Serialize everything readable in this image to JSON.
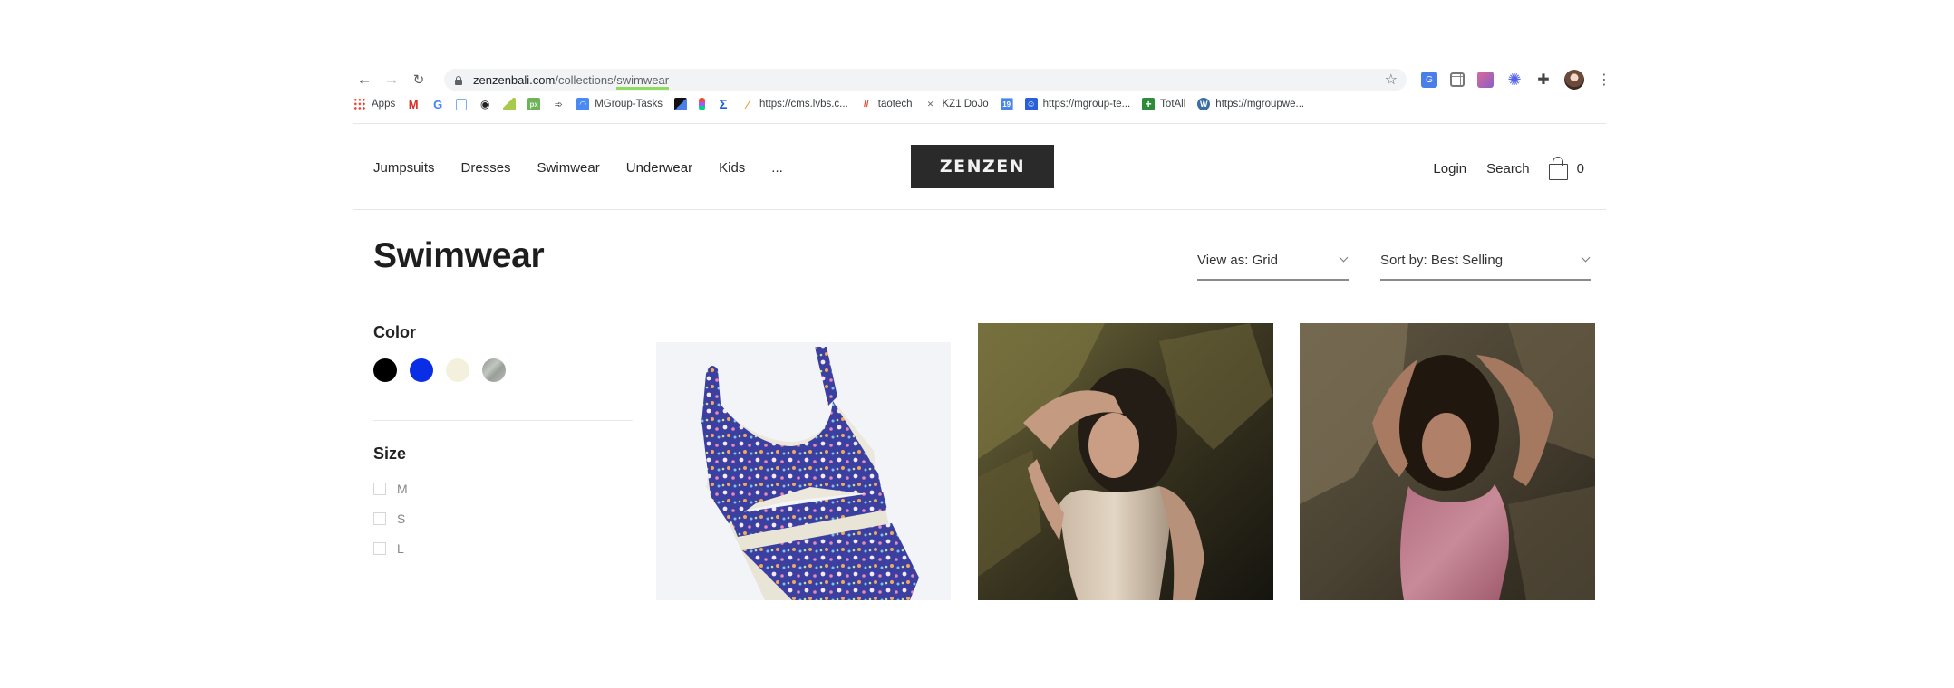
{
  "browser": {
    "url_host": "zenzenbali.com",
    "url_path_prefix": "/collections/",
    "url_path_highlight": "swimwear",
    "nav": {
      "back_icon": "←",
      "forward_icon": "→",
      "reload_icon": "↻"
    },
    "star_icon": "☆",
    "extensions": [
      {
        "name": "translate-extension-icon"
      },
      {
        "name": "grid-extension-icon"
      },
      {
        "name": "gradient-extension-icon"
      },
      {
        "name": "gear-extension-icon"
      },
      {
        "name": "puzzle-extensions-icon"
      }
    ],
    "menu_icon": "⋮",
    "bookmarks": [
      {
        "icon": "apps-icon",
        "label": "Apps"
      },
      {
        "icon": "gmail-icon",
        "label": ""
      },
      {
        "icon": "google-icon",
        "label": ""
      },
      {
        "icon": "doc-icon",
        "label": ""
      },
      {
        "icon": "eye-icon",
        "label": ""
      },
      {
        "icon": "leaf-icon",
        "label": ""
      },
      {
        "icon": "px-icon",
        "label": ""
      },
      {
        "icon": "arrow-icon",
        "label": ""
      },
      {
        "icon": "wifi-icon",
        "label": "MGroup-Tasks"
      },
      {
        "icon": "split-square-icon",
        "label": ""
      },
      {
        "icon": "figma-icon",
        "label": ""
      },
      {
        "icon": "sigma-icon",
        "label": ""
      },
      {
        "icon": "feather-icon",
        "label": "https://cms.lvbs.c..."
      },
      {
        "icon": "monday-icon",
        "label": "taotech"
      },
      {
        "icon": "kz-icon",
        "label": "KZ1 DoJo"
      },
      {
        "icon": "calendar-icon",
        "label": ""
      },
      {
        "icon": "face-icon",
        "label": "https://mgroup-te..."
      },
      {
        "icon": "plus-icon",
        "label": "TotAll"
      },
      {
        "icon": "wordpress-icon",
        "label": "https://mgroupwe..."
      }
    ]
  },
  "site": {
    "nav": [
      "Jumpsuits",
      "Dresses",
      "Swimwear",
      "Underwear",
      "Kids",
      "..."
    ],
    "logo": "ZENZEN",
    "login": "Login",
    "search": "Search",
    "cart_count": "0"
  },
  "collection": {
    "title": "Swimwear",
    "view_as": "View as: Grid",
    "sort_by": "Sort by: Best Selling"
  },
  "filters": {
    "color_title": "Color",
    "colors": [
      {
        "name": "black",
        "hex": "#000000"
      },
      {
        "name": "blue",
        "hex": "#0a2ee6"
      },
      {
        "name": "cream",
        "hex": "#f3f1de"
      },
      {
        "name": "grey-marble",
        "hex": "#a6aaa4"
      }
    ],
    "size_title": "Size",
    "sizes": [
      "M",
      "S",
      "L"
    ]
  },
  "products": [
    {
      "image": "floral blue cut-out swimsuit on white"
    },
    {
      "image": "model in nude one-piece against rocks"
    },
    {
      "image": "model in pink one-piece against rocks"
    }
  ]
}
